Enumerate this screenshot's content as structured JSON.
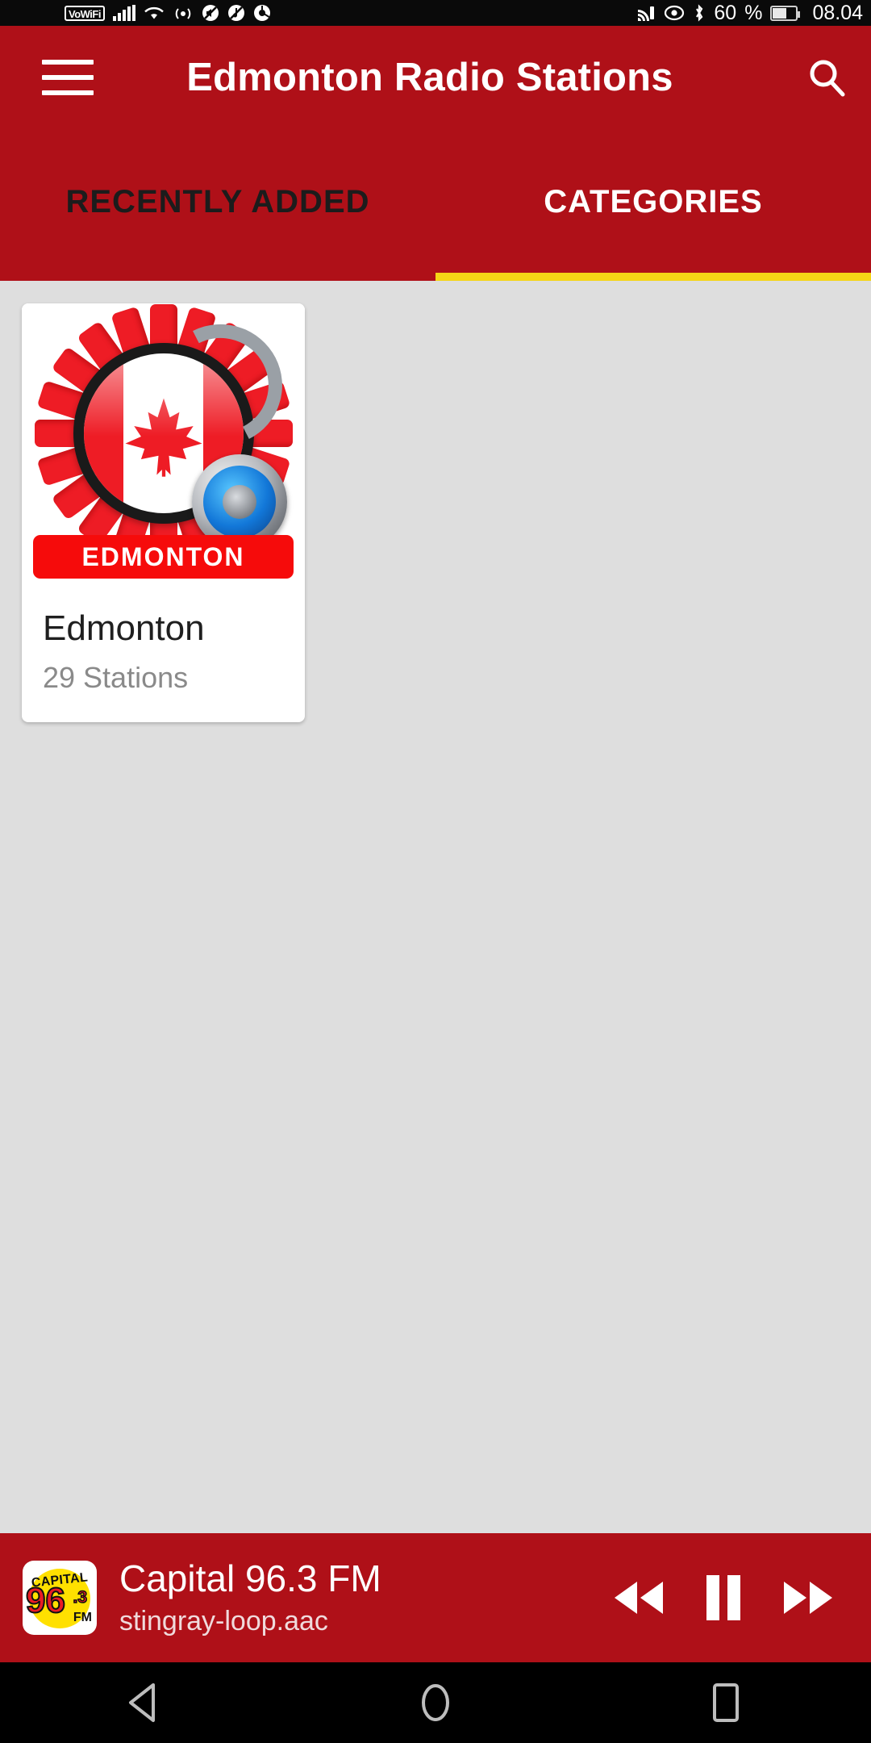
{
  "statusbar": {
    "vowifi_label": "VoWiFi",
    "icons_left": [
      "vowifi-icon",
      "signal-bars-icon",
      "wifi-icon",
      "hotspot-icon",
      "mute-icon",
      "vibrate-icon",
      "browser-icon"
    ],
    "icons_right": [
      "cast-icon",
      "eye-icon",
      "bluetooth-icon"
    ],
    "battery_percent": "60",
    "percent_symbol": "%",
    "clock": "08.04"
  },
  "appbar": {
    "menu_icon": "hamburger-menu-icon",
    "title": "Edmonton Radio Stations",
    "search_icon": "search-icon",
    "background": "#AF1018"
  },
  "tabs": {
    "items": [
      {
        "label": "RECENTLY ADDED",
        "active": false
      },
      {
        "label": "CATEGORIES",
        "active": true
      }
    ],
    "indicator_color": "#F5D516"
  },
  "content": {
    "background": "#DEDEDE",
    "cards": [
      {
        "title": "Edmonton",
        "subtitle": "29 Stations",
        "thumb_banner": "EDMONTON",
        "thumb_alt": "canadian-flag-headphones-icon"
      }
    ]
  },
  "player": {
    "logo": {
      "capital": "CAPITAL",
      "number": "96",
      "decimal": ".3",
      "fm": "FM"
    },
    "title": "Capital 96.3 FM",
    "subtitle": "stingray-loop.aac",
    "controls": [
      {
        "name": "rewind-button",
        "icon": "rewind-icon"
      },
      {
        "name": "pause-button",
        "icon": "pause-icon"
      },
      {
        "name": "fast-forward-button",
        "icon": "fast-forward-icon"
      }
    ],
    "background": "#AF1018"
  },
  "navbar": {
    "back_label": "back-icon",
    "home_label": "home-icon",
    "recents_label": "recents-icon"
  }
}
